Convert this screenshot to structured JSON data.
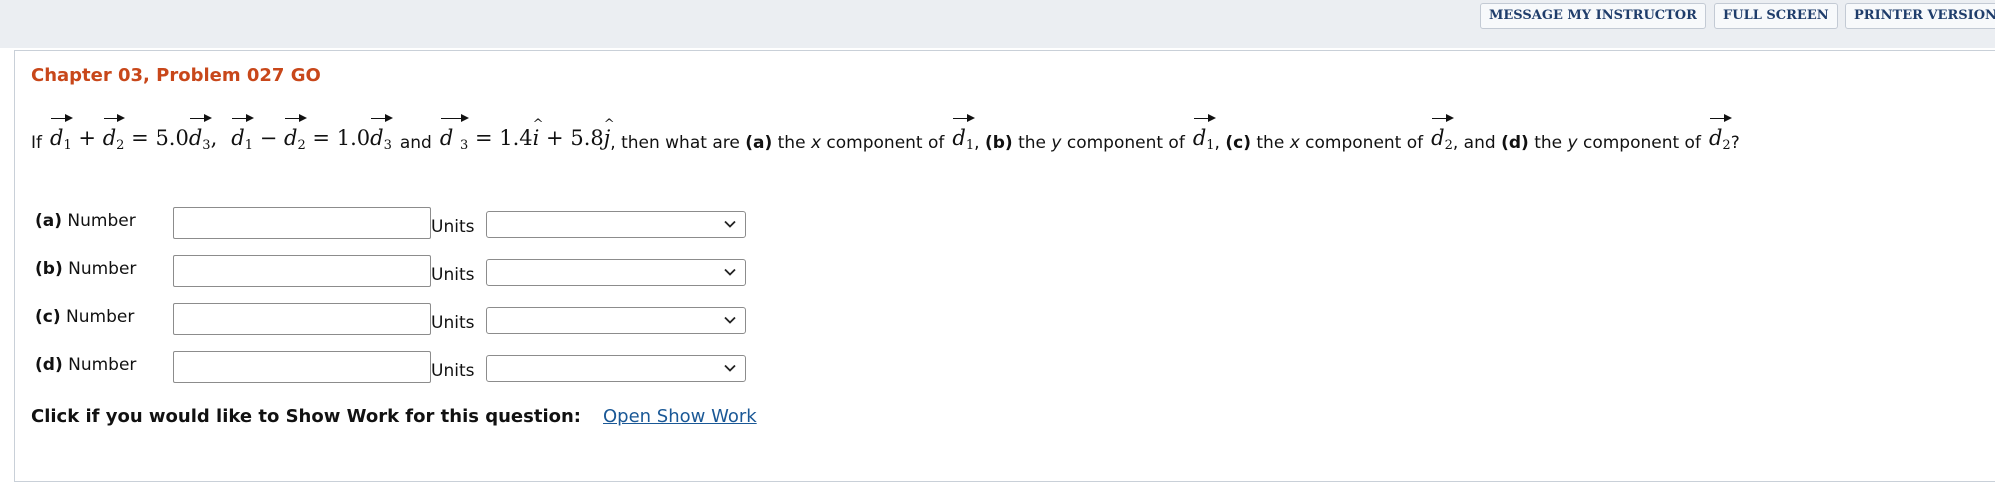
{
  "header": {
    "buttons": [
      {
        "label": "MESSAGE MY INSTRUCTOR"
      },
      {
        "label": "FULL SCREEN"
      },
      {
        "label": "PRINTER VERSION"
      }
    ]
  },
  "problem": {
    "title": "Chapter 03, Problem 027 GO",
    "question": {
      "if": "If",
      "d": "d",
      "n1": "1",
      "n2": "2",
      "n3": "3",
      "plus": "+",
      "minus": "−",
      "eq": "=",
      "coef1": "5.0",
      "coef2": "1.0",
      "comma": ",",
      "and": "and",
      "cx": "1.4",
      "cy": "5.8",
      "i": "i",
      "j": "j",
      "then": ", then what are",
      "a": "(a)",
      "b": "(b)",
      "c": "(c)",
      "dd": "(d)",
      "the": "the",
      "x": "x",
      "y": "y",
      "component_of": "component of",
      "and2": ", and",
      "q": "?"
    },
    "answers": [
      {
        "label": "(a)",
        "number_label": "Number",
        "value": "",
        "units_label": "Units",
        "units_value": ""
      },
      {
        "label": "(b)",
        "number_label": "Number",
        "value": "",
        "units_label": "Units",
        "units_value": ""
      },
      {
        "label": "(c)",
        "number_label": "Number",
        "value": "",
        "units_label": "Units",
        "units_value": ""
      },
      {
        "label": "(d)",
        "number_label": "Number",
        "value": "",
        "units_label": "Units",
        "units_value": ""
      }
    ],
    "show_work": {
      "prompt": "Click if you would like to Show Work for this question:",
      "link": "Open Show Work"
    }
  }
}
